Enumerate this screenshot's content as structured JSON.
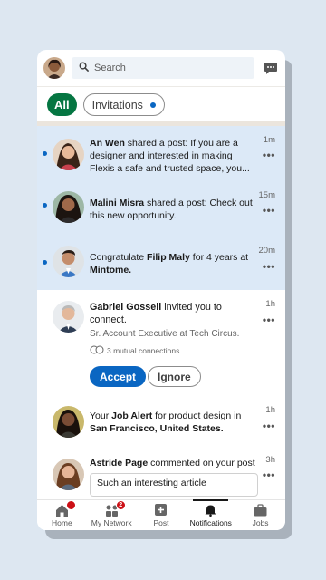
{
  "search": {
    "placeholder": "Search"
  },
  "filters": {
    "all": "All",
    "invitations": "Invitations"
  },
  "notifications": [
    {
      "name": "An Wen",
      "text": " shared a post: If you are a designer and interested in making Flexis a safe and trusted space, you...",
      "time": "1m"
    },
    {
      "name": "Malini Misra",
      "text": " shared a post: Check out this new opportunity.",
      "time": "15m"
    },
    {
      "pre": "Congratulate ",
      "name": "Filip Maly",
      "mid": " for 4 years at ",
      "company": "Mintome.",
      "time": "20m"
    },
    {
      "name": "Gabriel Gosseli",
      "text": " invited you to connect.",
      "subtitle": "Sr. Account Executive at Tech Circus.",
      "mutual": "3 mutual connections",
      "accept": "Accept",
      "ignore": "Ignore",
      "time": "1h"
    },
    {
      "pre": "Your ",
      "name": "Job Alert",
      "mid": " for product design in ",
      "company": "San Francisco, United States.",
      "time": "1h"
    },
    {
      "name": "Astride Page",
      "text": " commented on your post",
      "comment": "Such an interesting article",
      "time": "3h"
    }
  ],
  "more_label": "•••",
  "nav": [
    {
      "label": "Home",
      "badge": ""
    },
    {
      "label": "My Network",
      "badge": "2"
    },
    {
      "label": "Post"
    },
    {
      "label": "Notifications"
    },
    {
      "label": "Jobs"
    }
  ],
  "colors": {
    "brand_green": "#057642",
    "accent_blue": "#0a66c2",
    "unread_bg": "#dce9f7",
    "badge_red": "#cc1016"
  }
}
